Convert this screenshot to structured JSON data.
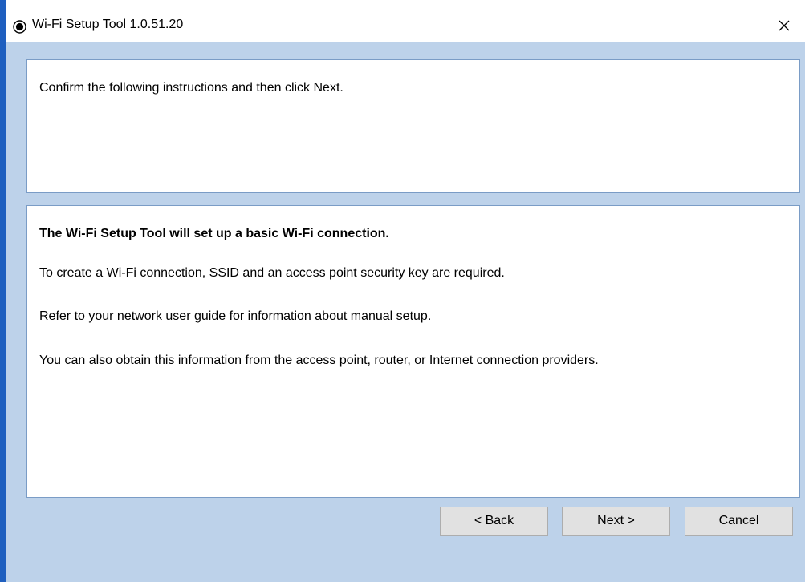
{
  "window": {
    "title": "Wi-Fi Setup Tool 1.0.51.20",
    "close_glyph": "✕",
    "accent_color": "#1f5fbf",
    "background_color": "#bdd2ea"
  },
  "instruction_panel": {
    "text": "Confirm the following instructions and then click Next."
  },
  "info_panel": {
    "heading": "The Wi-Fi Setup Tool will set up a basic Wi-Fi connection.",
    "paragraphs": [
      "To create a Wi-Fi connection, SSID and an access point security key are required.",
      "Refer to your network user guide for information about manual setup.",
      "You can also obtain this information from the access point, router, or Internet connection providers."
    ]
  },
  "buttons": {
    "back": "< Back",
    "next": "Next >",
    "cancel": "Cancel"
  }
}
